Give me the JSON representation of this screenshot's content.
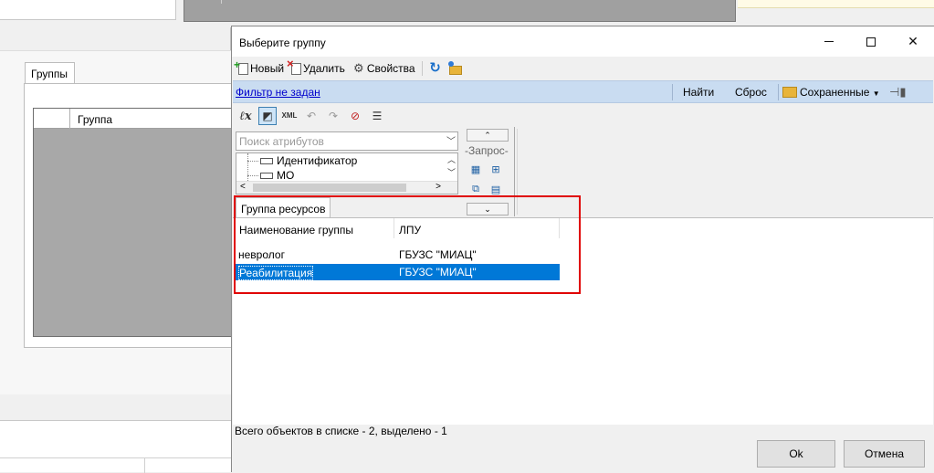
{
  "dialog": {
    "title": "Выберите группу"
  },
  "toolbar": {
    "new_label": "Новый",
    "delete_label": "Удалить",
    "properties_label": "Свойства"
  },
  "filter": {
    "status_link": "Фильтр не задан",
    "find_label": "Найти",
    "reset_label": "Сброс",
    "saved_label": "Сохраненные"
  },
  "attributes": {
    "search_placeholder": "Поиск атрибутов",
    "items": [
      "Идентификатор",
      "МО"
    ]
  },
  "query": {
    "label": "-Запрос-"
  },
  "tabs": {
    "resource_group": "Группа ресурсов"
  },
  "grid": {
    "columns": [
      "Наименование группы",
      "ЛПУ"
    ],
    "rows": [
      {
        "name": "невролог",
        "lpu": "ГБУЗС \"МИАЦ\"",
        "selected": false
      },
      {
        "name": "Реабилитация",
        "lpu": "ГБУЗС \"МИАЦ\"",
        "selected": true
      }
    ]
  },
  "status_text": "Всего объектов в списке - 2, выделено - 1",
  "buttons": {
    "ok": "Ok",
    "cancel": "Отмена"
  },
  "background": {
    "tab_label": "Группы",
    "column_label": "Группа"
  },
  "colors": {
    "selection": "#0078d7",
    "filter_bar": "#c9dcf1",
    "highlight": "#e00000"
  }
}
